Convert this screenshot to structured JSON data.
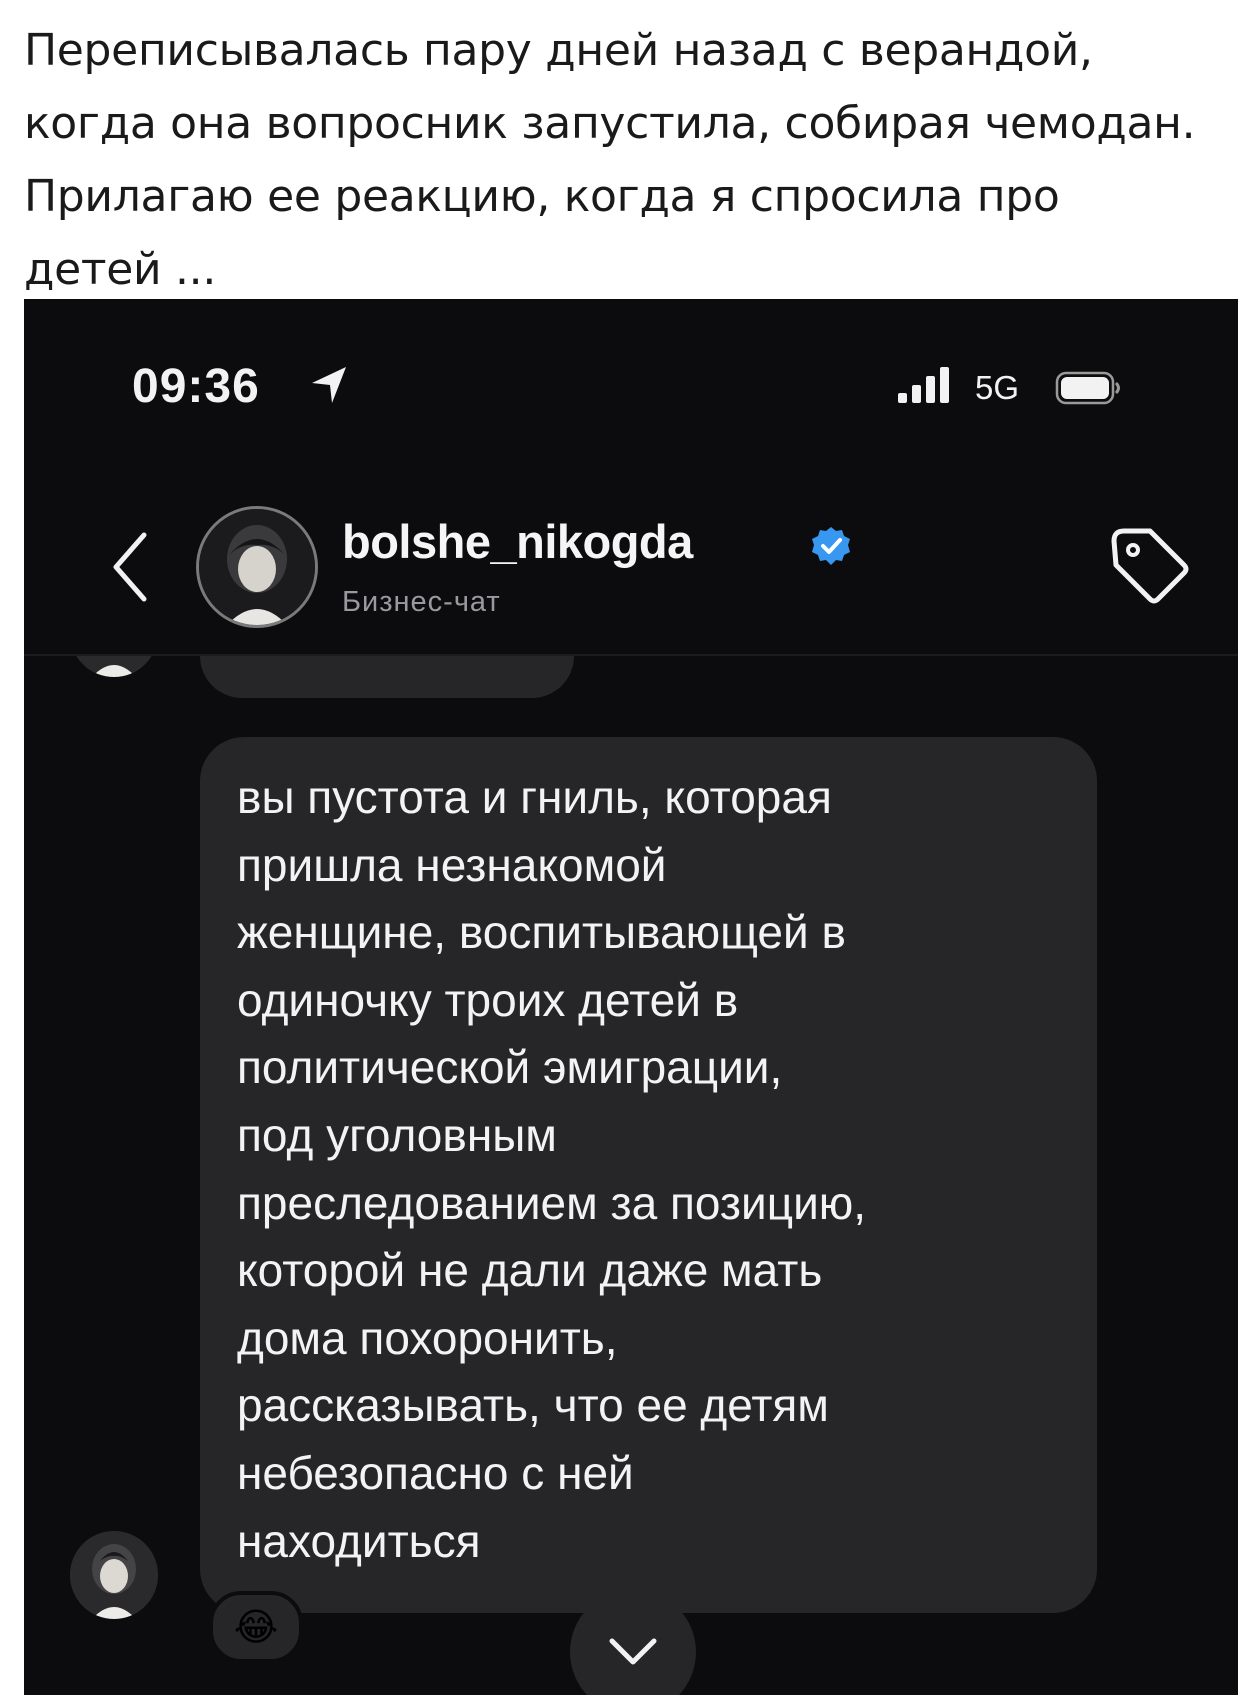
{
  "post": {
    "caption": "Переписывалась пару дней назад с верандой,\nкогда она вопросник запустила, собирая чемодан.\nПрилагаю ее реакцию, когда я спросила про\nдетей ..."
  },
  "status_bar": {
    "time": "09:36",
    "network": "5G",
    "icons": [
      "location-arrow-icon",
      "signal-bars-icon",
      "battery-icon"
    ]
  },
  "chat_header": {
    "username": "bolshe_nikogda",
    "subtitle": "Бизнес-чат",
    "verified": true,
    "verified_color": "#3897f0",
    "icons": [
      "back-chevron-icon",
      "avatar",
      "verified-badge-icon",
      "tag-icon"
    ]
  },
  "messages": [
    {
      "text": "вы пустота и гниль, которая\nпришла незнакомой\nженщине, воспитывающей в\nодиночку троих детей в\nполитической эмиграции,\nпод уголовным\nпреследованием за позицию,\nкоторой не дали даже мать\nдома похоронить,\nрассказывать, что ее детям\nнебезопасно с ней\nнаходиться",
      "reaction": "😂"
    }
  ],
  "colors": {
    "background": "#0c0c0e",
    "bubble": "#262628",
    "text": "#f3f3f3",
    "secondary_text": "#9a9a9e"
  }
}
